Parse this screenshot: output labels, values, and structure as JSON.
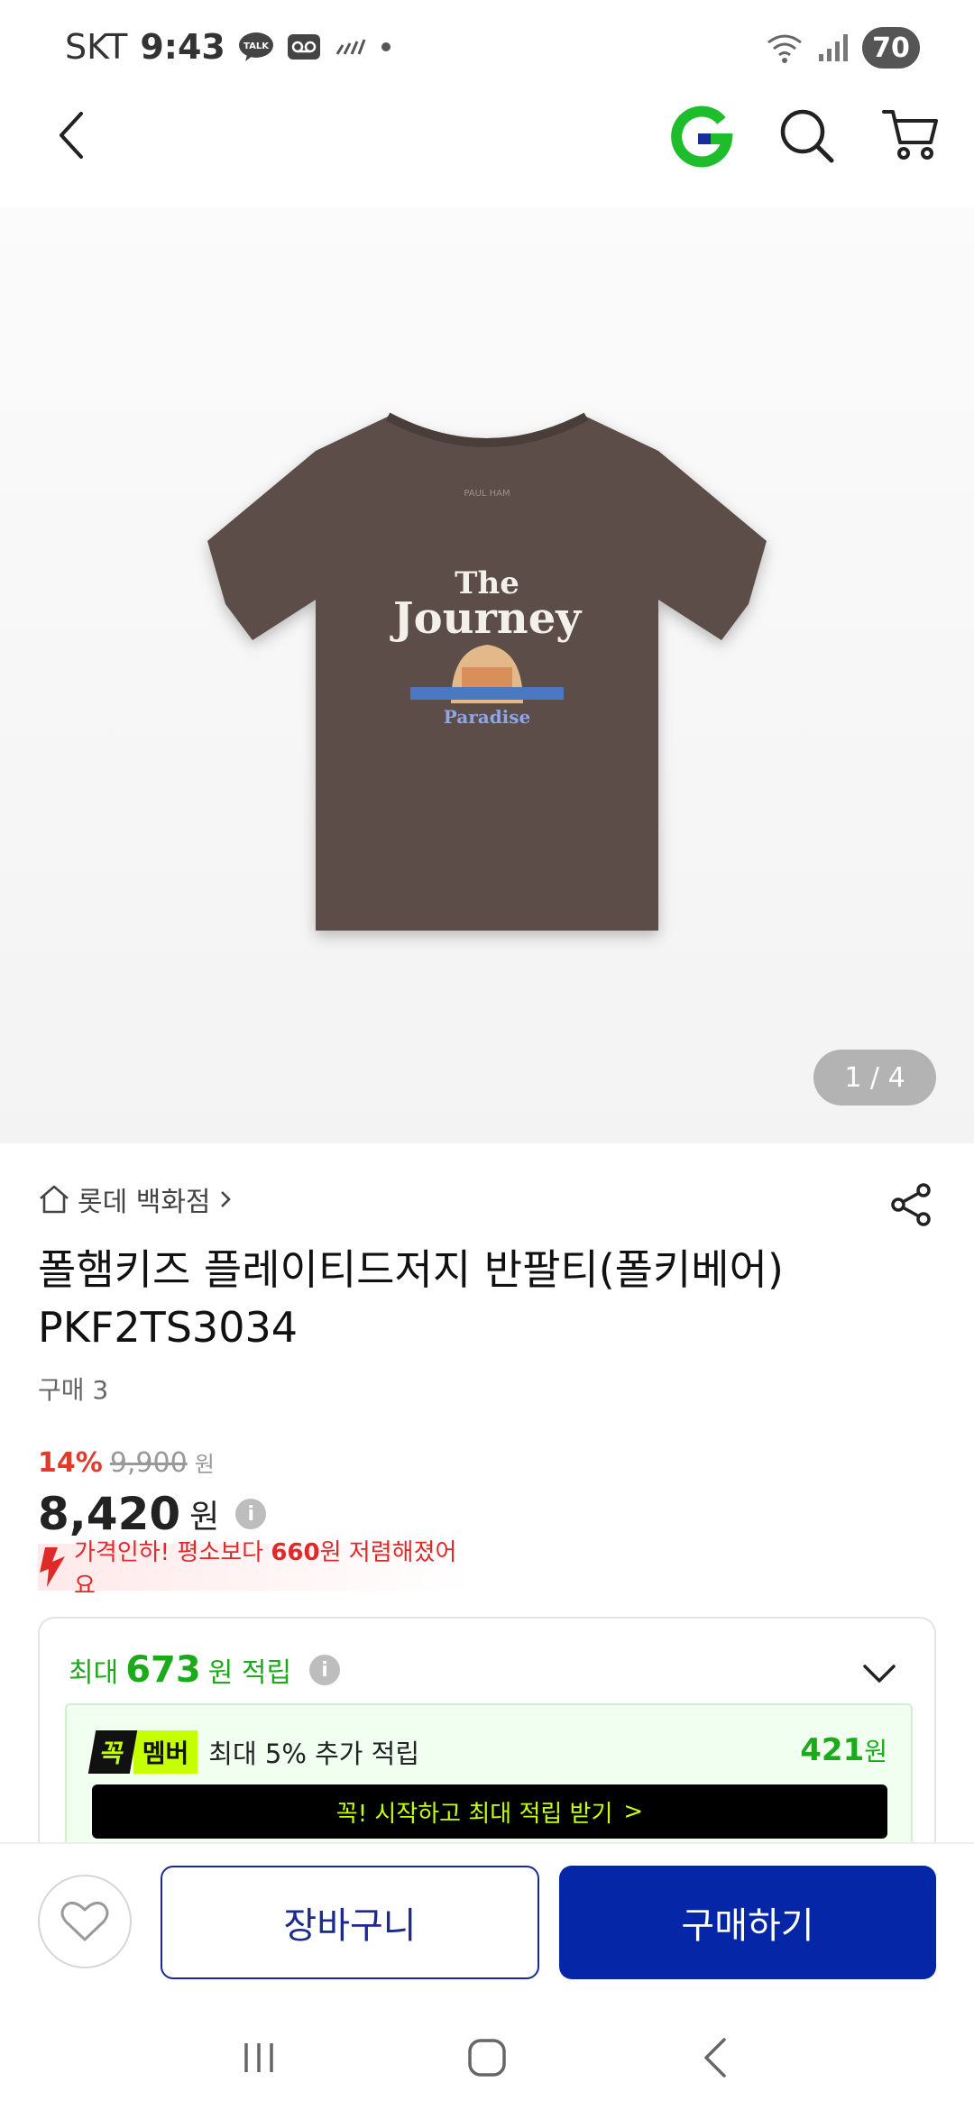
{
  "status_bar": {
    "carrier": "SKT",
    "time": "9:43",
    "battery": "70"
  },
  "header": {
    "icons": [
      "back-icon",
      "gmarket-logo-icon",
      "search-icon",
      "cart-icon"
    ],
    "logo_letter": "G"
  },
  "gallery": {
    "counter": "1 / 4",
    "print_top": "The",
    "print_main": "Journey",
    "print_bottom": "Paradise"
  },
  "product": {
    "store": "롯데 백화점",
    "title": "폴햄키즈 플레이티드저지 반팔티(폴키베어) PKF2TS3034",
    "purchase_count": "구매 3",
    "discount_rate": "14%",
    "original_price": "9,900",
    "original_unit": "원",
    "price": "8,420",
    "price_unit": "원",
    "price_drop_prefix": "가격인하! 평소보다 ",
    "price_drop_amount": "660",
    "price_drop_suffix": "원 저렴해졌어요"
  },
  "points": {
    "prefix": "최대",
    "amount": "673",
    "suffix": "원 적립",
    "member_badge_1": "꼭",
    "member_badge_2": "멤버",
    "member_text": "최대 5% 추가 적립",
    "member_amount": "421",
    "member_unit": "원",
    "cta": "꼭! 시작하고 최대 적립 받기",
    "cta_arrow": ">"
  },
  "actions": {
    "cart_label": "장바구니",
    "buy_label": "구매하기"
  },
  "colors": {
    "brand_blue": "#0626a8",
    "discount_red": "#e23b2c",
    "points_green": "#1aaa1a",
    "member_lime": "#c6ff00"
  }
}
